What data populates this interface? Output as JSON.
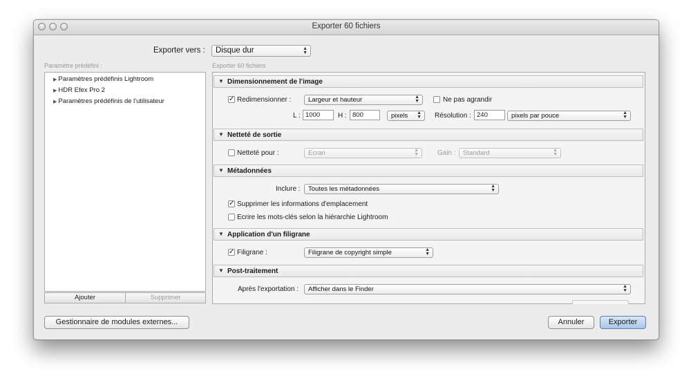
{
  "window": {
    "title": "Exporter 60 fichiers"
  },
  "export_to": {
    "label": "Exporter vers :",
    "value": "Disque dur"
  },
  "presets": {
    "heading": "Paramètre prédéfini :",
    "items": [
      "Paramètres prédéfinis Lightroom",
      "HDR Efex Pro 2",
      "Paramètres prédéfinis de l'utilisateur"
    ],
    "add_label": "Ajouter",
    "remove_label": "Supprimer"
  },
  "panel_heading": "Exporter 60 fichiers",
  "sections": {
    "sizing": {
      "title": "Dimensionnement de l'image",
      "resize_label": "Redimensionner :",
      "resize_checked": true,
      "resize_mode": "Largeur et hauteur",
      "dont_enlarge_label": "Ne pas agrandir",
      "dont_enlarge_checked": false,
      "w_label": "L :",
      "w_value": "1000",
      "h_label": "H :",
      "h_value": "800",
      "unit": "pixels",
      "resolution_label": "Résolution :",
      "resolution_value": "240",
      "resolution_unit": "pixels par pouce"
    },
    "sharpening": {
      "title": "Netteté de sortie",
      "sharpen_label": "Netteté pour :",
      "sharpen_checked": false,
      "sharpen_for": "Ecran",
      "amount_label": "Gain :",
      "amount_value": "Standard"
    },
    "metadata": {
      "title": "Métadonnées",
      "include_label": "Inclure :",
      "include_value": "Toutes les métadonnées",
      "remove_location_label": "Supprimer les informations d'emplacement",
      "remove_location_checked": true,
      "hierarchy_label": "Ecrire les mots-clés selon la hiérarchie Lightroom",
      "hierarchy_checked": false
    },
    "watermark": {
      "title": "Application d'un filigrane",
      "watermark_label": "Filigrane :",
      "watermark_checked": true,
      "watermark_value": "Filigrane de copyright simple"
    },
    "post": {
      "title": "Post-traitement",
      "after_label": "Après l'exportation :",
      "after_value": "Afficher dans le Finder"
    }
  },
  "footer": {
    "plugin_manager_label": "Gestionnaire de modules externes...",
    "cancel_label": "Annuler",
    "export_label": "Exporter"
  },
  "icons": {
    "checkmark": "✓",
    "disclosure_open": "▼",
    "disclosure_closed": "▶"
  }
}
